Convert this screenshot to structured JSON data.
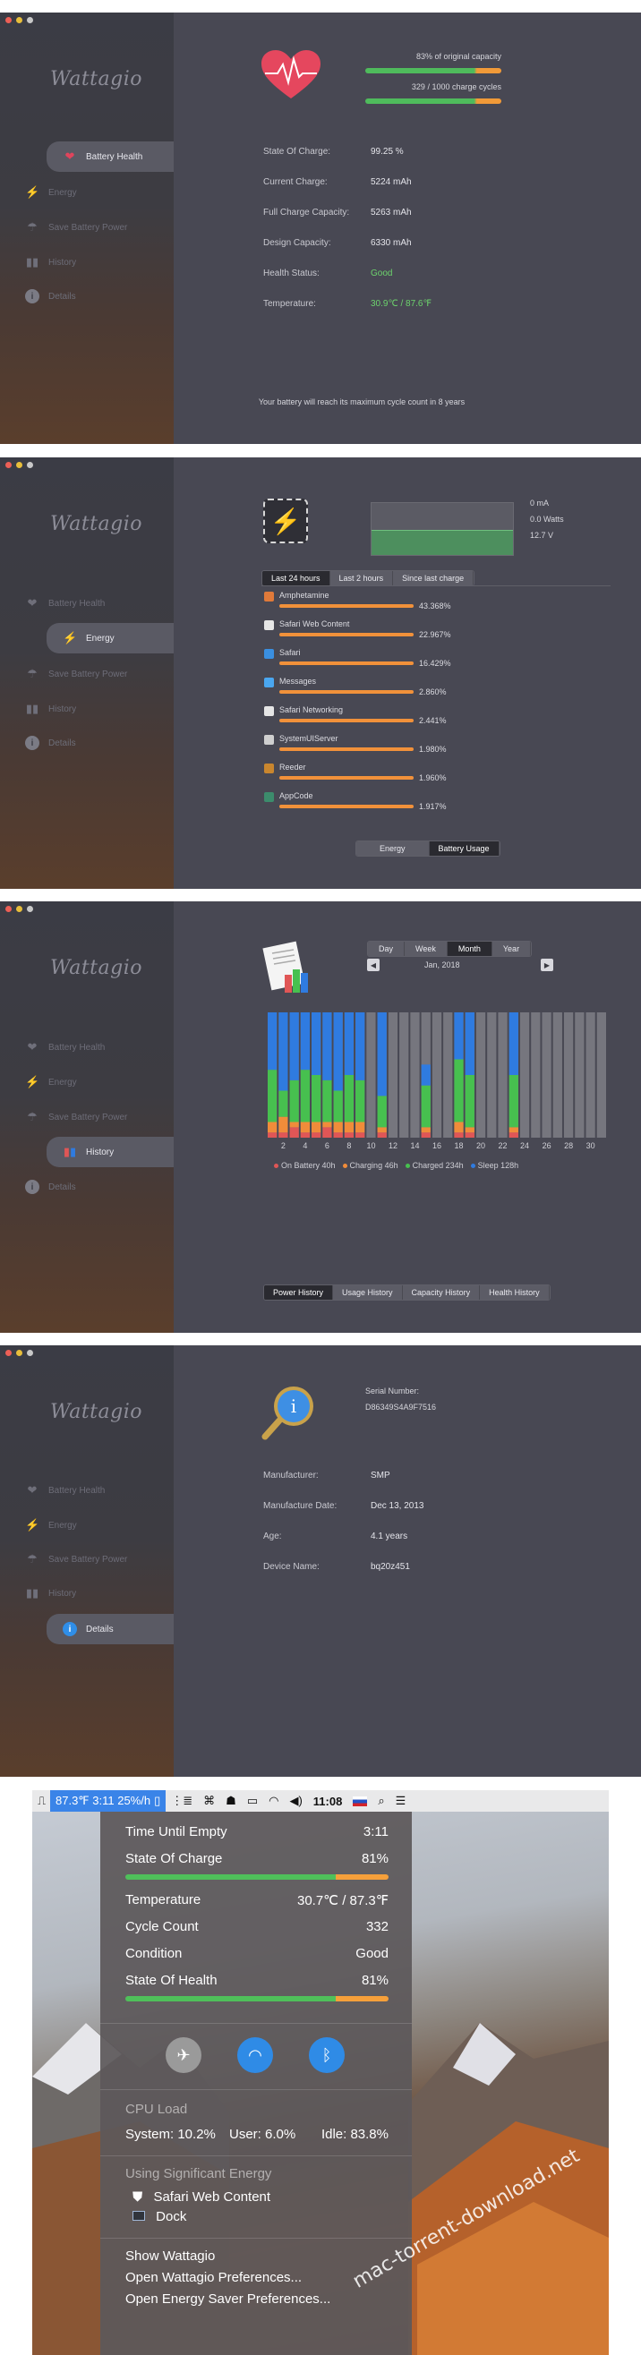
{
  "app_name": "Wattagio",
  "nav": {
    "battery_health": "Battery Health",
    "energy": "Energy",
    "save_battery_power": "Save Battery Power",
    "history": "History",
    "details": "Details"
  },
  "health": {
    "capacity_text": "83% of original capacity",
    "capacity_fraction": 0.83,
    "cycles_text": "329 / 1000 charge cycles",
    "cycles_fraction": 0.329,
    "rows": [
      {
        "label": "State Of Charge:",
        "value": "99.25 %"
      },
      {
        "label": "Current Charge:",
        "value": "5224 mAh"
      },
      {
        "label": "Full Charge Capacity:",
        "value": "5263 mAh"
      },
      {
        "label": "Design Capacity:",
        "value": "6330 mAh"
      },
      {
        "label": "Health Status:",
        "value": "Good"
      },
      {
        "label": "Temperature:",
        "value": "30.9℃ / 87.6℉"
      }
    ],
    "footer": "Your battery will reach its maximum cycle count in 8 years"
  },
  "energy": {
    "readings": [
      "0 mA",
      "0.0 Watts",
      "12.7 V"
    ],
    "tabs": [
      "Last 24 hours",
      "Last 2 hours",
      "Since last charge"
    ],
    "apps": [
      {
        "name": "Amphetamine",
        "pct": "43.368%",
        "value": 43.368,
        "color": "#e07a3a"
      },
      {
        "name": "Safari Web Content",
        "pct": "22.967%",
        "value": 22.967,
        "color": "#e6e6e6"
      },
      {
        "name": "Safari",
        "pct": "16.429%",
        "value": 16.429,
        "color": "#3a8fe0"
      },
      {
        "name": "Messages",
        "pct": "2.860%",
        "value": 2.86,
        "color": "#4aa7f0"
      },
      {
        "name": "Safari Networking",
        "pct": "2.441%",
        "value": 2.441,
        "color": "#e6e6e6"
      },
      {
        "name": "SystemUIServer",
        "pct": "1.980%",
        "value": 1.98,
        "color": "#cfcfcf"
      },
      {
        "name": "Reeder",
        "pct": "1.960%",
        "value": 1.96,
        "color": "#c9862e"
      },
      {
        "name": "AppCode",
        "pct": "1.917%",
        "value": 1.917,
        "color": "#3c8c6c"
      }
    ],
    "bottom_tabs": [
      "Energy",
      "Battery Usage"
    ]
  },
  "history": {
    "period_tabs": [
      "Day",
      "Week",
      "Month",
      "Year"
    ],
    "month_label": "Jan, 2018",
    "bottom_tabs": [
      "Power History",
      "Usage History",
      "Capacity History",
      "Health History"
    ],
    "legend": [
      {
        "label": "On Battery 40h",
        "color": "#e05656"
      },
      {
        "label": "Charging 46h",
        "color": "#f08c3a"
      },
      {
        "label": "Charged 234h",
        "color": "#47c04f"
      },
      {
        "label": "Sleep 128h",
        "color": "#2f7be0"
      }
    ]
  },
  "chart_data": {
    "type": "bar",
    "stacked": true,
    "categories": [
      "1",
      "2",
      "3",
      "4",
      "5",
      "6",
      "7",
      "8",
      "9",
      "10",
      "11",
      "12",
      "13",
      "14",
      "15",
      "16",
      "17",
      "18",
      "19",
      "20",
      "21",
      "22",
      "23",
      "24",
      "25",
      "26",
      "27",
      "28",
      "29",
      "30",
      "31"
    ],
    "x_tick_labels": [
      "2",
      "4",
      "6",
      "8",
      "10",
      "12",
      "14",
      "16",
      "18",
      "20",
      "22",
      "24",
      "26",
      "28",
      "30"
    ],
    "ylim": [
      0,
      24
    ],
    "series": [
      {
        "name": "On Battery",
        "color": "#e05656",
        "values": [
          1,
          1,
          2,
          1,
          1,
          2,
          1,
          1,
          1,
          0,
          1,
          0,
          0,
          0,
          1,
          0,
          0,
          1,
          1,
          0,
          0,
          0,
          1,
          0,
          0,
          0,
          0,
          0,
          0,
          0,
          0
        ]
      },
      {
        "name": "Charging",
        "color": "#f08c3a",
        "values": [
          2,
          3,
          1,
          2,
          2,
          1,
          2,
          2,
          2,
          0,
          1,
          0,
          0,
          0,
          1,
          0,
          0,
          2,
          1,
          0,
          0,
          0,
          1,
          0,
          0,
          0,
          0,
          0,
          0,
          0,
          0
        ]
      },
      {
        "name": "Charged",
        "color": "#47c04f",
        "values": [
          10,
          5,
          8,
          10,
          9,
          8,
          6,
          9,
          8,
          0,
          6,
          0,
          0,
          0,
          8,
          0,
          0,
          12,
          10,
          0,
          0,
          0,
          10,
          0,
          0,
          0,
          0,
          0,
          0,
          0,
          0
        ]
      },
      {
        "name": "Sleep",
        "color": "#2f7be0",
        "values": [
          11,
          15,
          13,
          11,
          12,
          13,
          15,
          12,
          13,
          0,
          16,
          0,
          0,
          0,
          4,
          0,
          0,
          9,
          12,
          0,
          0,
          0,
          12,
          0,
          0,
          0,
          0,
          0,
          0,
          0,
          0
        ]
      }
    ]
  },
  "details": {
    "serial_label": "Serial Number:",
    "serial_value": "D86349S4A9F7516",
    "rows": [
      {
        "label": "Manufacturer:",
        "value": "SMP"
      },
      {
        "label": "Manufacture Date:",
        "value": "Dec 13, 2013"
      },
      {
        "label": "Age:",
        "value": "4.1 years"
      },
      {
        "label": "Device Name:",
        "value": "bq20z451"
      }
    ]
  },
  "menubar": {
    "battery_text": "87.3℉ 3:11 25%/h",
    "clock": "11:08"
  },
  "popover": {
    "rows1": [
      {
        "label": "Time Until Empty",
        "value": "3:11"
      },
      {
        "label": "State Of Charge",
        "value": "81%"
      }
    ],
    "rows2": [
      {
        "label": "Temperature",
        "value": "30.7℃ / 87.3℉"
      },
      {
        "label": "Cycle Count",
        "value": "332"
      },
      {
        "label": "Condition",
        "value": "Good"
      },
      {
        "label": "State Of Health",
        "value": "81%"
      }
    ],
    "cpu_title": "CPU Load",
    "cpu_system": "System: 10.2%",
    "cpu_user": "User: 6.0%",
    "cpu_idle": "Idle: 83.8%",
    "energy_title": "Using Significant  Energy",
    "energy_apps": [
      "Safari Web Content",
      "Dock"
    ],
    "actions": [
      "Show Wattagio",
      "Open Wattagio Preferences...",
      "Open Energy Saver Preferences..."
    ]
  },
  "watermark": "mac-torrent-download.net"
}
